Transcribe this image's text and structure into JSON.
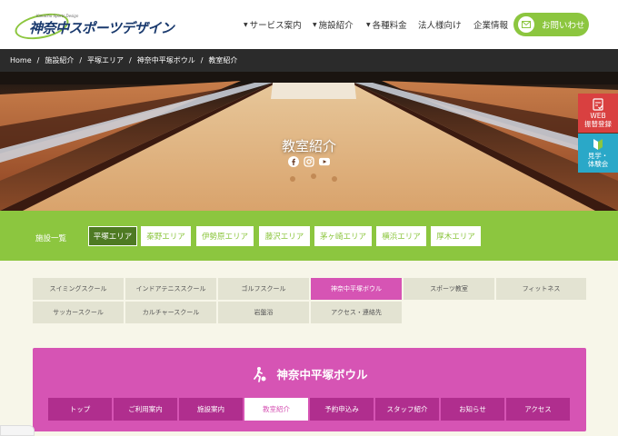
{
  "header": {
    "logo_small": "Kanachu Sports Design",
    "logo_main": "神奈中スポーツデザイン",
    "nav": [
      {
        "label": "サービス案内",
        "dropdown": true
      },
      {
        "label": "施設紹介",
        "dropdown": true
      },
      {
        "label": "各種料金",
        "dropdown": true
      },
      {
        "label": "法人様向け",
        "dropdown": false
      },
      {
        "label": "企業情報",
        "dropdown": false
      }
    ],
    "contact_label": "お問いわせ"
  },
  "breadcrumb": [
    "Home",
    "施設紹介",
    "平塚エリア",
    "神奈中平塚ボウル",
    "教室紹介"
  ],
  "hero": {
    "title": "教室紹介"
  },
  "side_tabs": {
    "web": "WEB\n振替登録",
    "visit": "見学・\n体験会"
  },
  "area": {
    "heading": "施設一覧",
    "items": [
      "平塚エリア",
      "秦野エリア",
      "伊勢原エリア",
      "藤沢エリア",
      "茅ヶ崎エリア",
      "横浜エリア",
      "厚木エリア"
    ],
    "active": 0
  },
  "services": {
    "rows": [
      [
        "スイミングスクール",
        "インドアテニススクール",
        "ゴルフスクール",
        "神奈中平塚ボウル",
        "スポーツ教室",
        "フィットネス"
      ],
      [
        "サッカースクール",
        "カルチャースクール",
        "岩盤浴",
        "アクセス・連絡先"
      ]
    ],
    "active": "神奈中平塚ボウル"
  },
  "facility": {
    "title": "神奈中平塚ボウル",
    "nav": [
      "トップ",
      "ご利用案内",
      "施設案内",
      "教室紹介",
      "予約申込み",
      "スタッフ紹介",
      "お知らせ",
      "アクセス"
    ],
    "active": 3
  },
  "colors": {
    "green": "#8cc63f",
    "dark_green": "#4e7a23",
    "magenta": "#d654b4",
    "dark_magenta": "#b02e8e",
    "red": "#d94040",
    "cyan": "#2aa8c8"
  }
}
